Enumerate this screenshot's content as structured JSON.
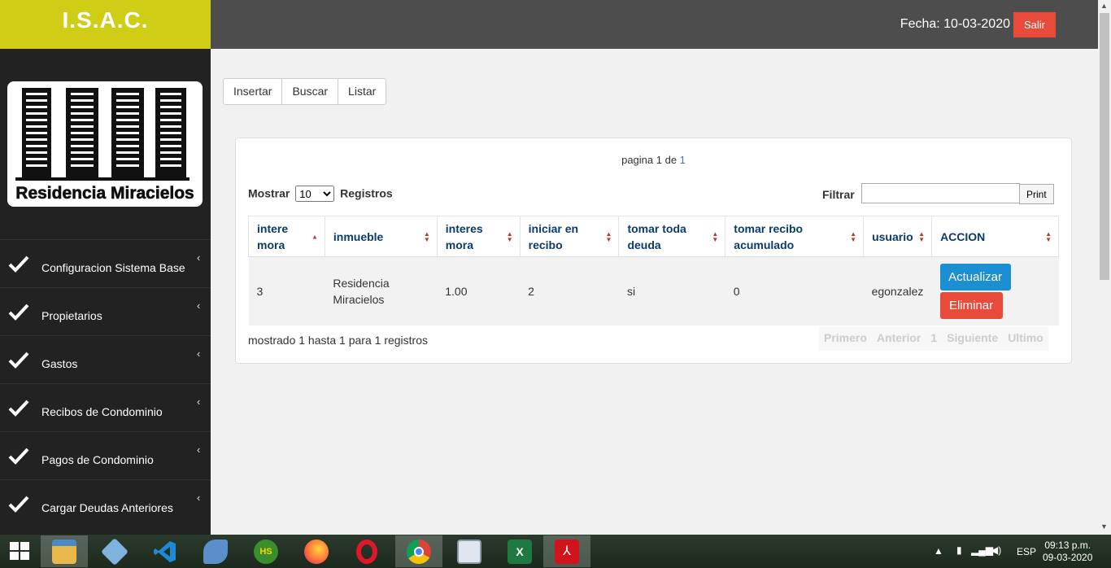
{
  "sidebar": {
    "brand": "I.S.A.C.",
    "logo_text": "Residencia Miracielos",
    "items": [
      {
        "label": "Configuracion Sistema Base"
      },
      {
        "label": "Propietarios"
      },
      {
        "label": "Gastos"
      },
      {
        "label": "Recibos de Condominio"
      },
      {
        "label": "Pagos de Condominio"
      },
      {
        "label": "Cargar Deudas Anteriores"
      }
    ],
    "chevron": "‹"
  },
  "header": {
    "fecha": "Fecha: 10-03-2020",
    "salir": "Salir"
  },
  "toolbar": {
    "insertar": "Insertar",
    "buscar": "Buscar",
    "listar": "Listar"
  },
  "panel": {
    "pagina_prefix": "pagina 1 de ",
    "pagina_total": "1",
    "mostrar_label": "Mostrar",
    "mostrar_value": "10",
    "registros_label": "Registros",
    "filtrar_label": "Filtrar",
    "filtrar_value": "",
    "print": "Print"
  },
  "table": {
    "headers": [
      {
        "line1": "intere",
        "line2": "mora"
      },
      {
        "line1": "inmueble",
        "line2": ""
      },
      {
        "line1": "interes",
        "line2": "mora"
      },
      {
        "line1": "iniciar en",
        "line2": "recibo"
      },
      {
        "line1": "tomar toda",
        "line2": "deuda"
      },
      {
        "line1": "tomar recibo",
        "line2": "acumulado"
      },
      {
        "line1": "usuario",
        "line2": ""
      },
      {
        "line1": "ACCION",
        "line2": ""
      }
    ],
    "rows": [
      {
        "c0": "3",
        "c1a": "Residencia",
        "c1b": "Miracielos",
        "c2": "1.00",
        "c3": "2",
        "c4": "si",
        "c5": "0",
        "c6": "egonzalez",
        "actualizar": "Actualizar",
        "eliminar": "Eliminar"
      }
    ]
  },
  "footer": {
    "info": "mostrado 1 hasta 1 para 1 registros",
    "pager": [
      "Primero",
      "Anterior",
      "1",
      "Siguiente",
      "Ultimo"
    ]
  },
  "taskbar": {
    "apps": [
      "start-icon",
      "file-explorer-icon",
      "virtualbox-icon",
      "vscode-icon",
      "dolphin-icon",
      "heidisql-icon",
      "firefox-icon",
      "opera-icon",
      "chrome-icon",
      "monitor-icon",
      "excel-icon",
      "acrobat-icon"
    ],
    "lang": "ESP",
    "time": "09:13 p.m.",
    "date": "09-03-2020"
  },
  "colors": {
    "brand": "#d0cd17",
    "topbar": "#4d4d4d",
    "sidebar": "#222222",
    "danger": "#e84b3a",
    "primary": "#1b8fd1",
    "header_text": "#0b3a6b"
  }
}
